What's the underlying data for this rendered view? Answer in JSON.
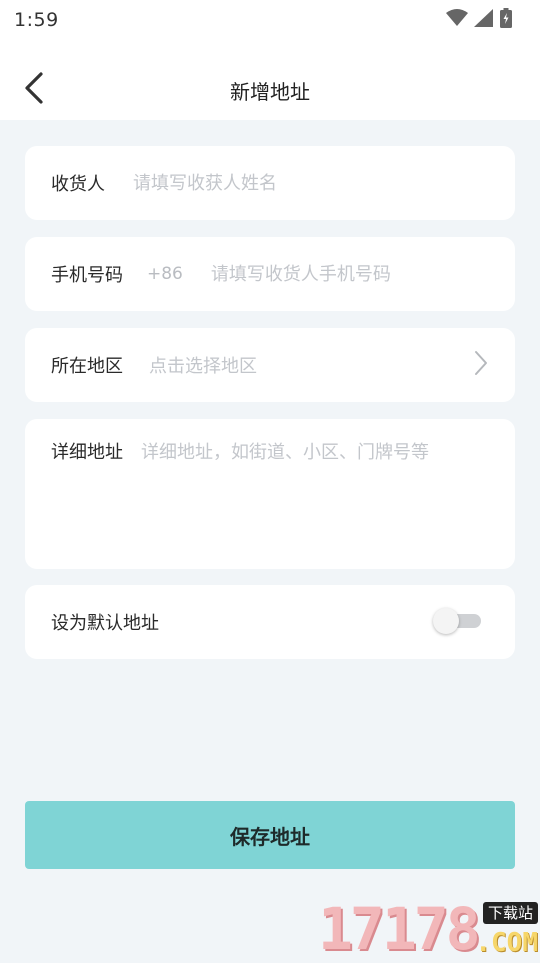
{
  "status_bar": {
    "time": "1:59",
    "icons": [
      "wifi-icon",
      "cellular-signal-icon",
      "battery-charging-icon"
    ]
  },
  "header": {
    "title": "新增地址",
    "back_icon": "chevron-left-icon"
  },
  "form": {
    "receiver": {
      "label": "收货人",
      "placeholder": "请填写收获人姓名",
      "value": ""
    },
    "phone": {
      "label": "手机号码",
      "country_code": "+86",
      "placeholder": "请填写收货人手机号码",
      "value": ""
    },
    "region": {
      "label": "所在地区",
      "placeholder": "点击选择地区",
      "arrow_icon": "chevron-right-icon"
    },
    "detail": {
      "label": "详细地址",
      "placeholder": "详细地址，如街道、小区、门牌号等",
      "value": ""
    },
    "default_address": {
      "label": "设为默认地址",
      "enabled": false
    }
  },
  "save_button": {
    "label": "保存地址"
  },
  "watermark": {
    "number": "17178",
    "tag": "下载站",
    "domain": ".COM"
  },
  "colors": {
    "page_background": "#f1f5f8",
    "card_background": "#ffffff",
    "accent_button": "#7fd4d5",
    "placeholder": "#c3c6cb"
  }
}
